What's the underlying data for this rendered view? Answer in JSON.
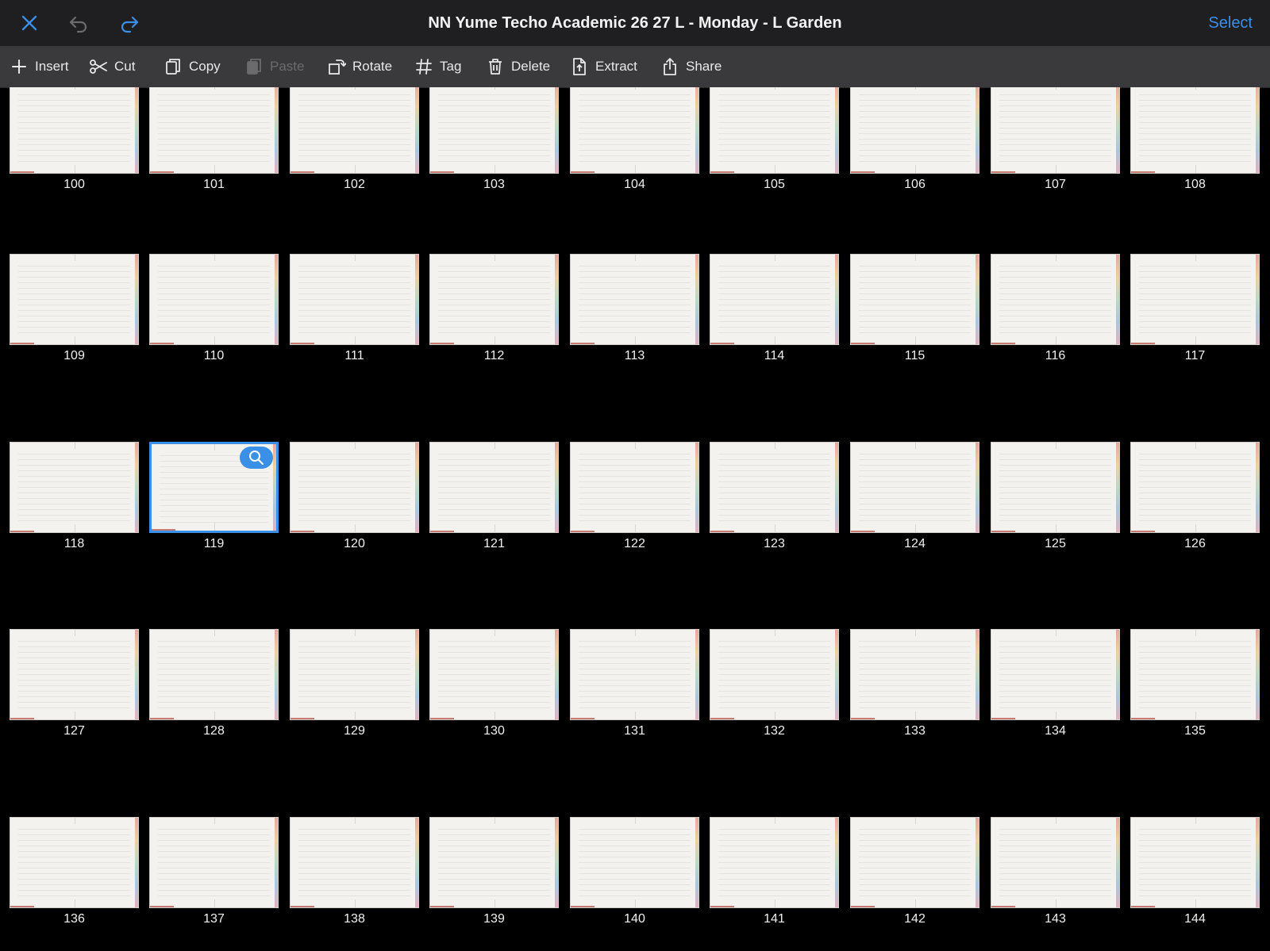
{
  "window": {
    "title": "NN Yume Techo Academic 26 27 L - Monday - L Garden",
    "select_label": "Select"
  },
  "colors": {
    "accent": "#3a8fe6",
    "titlebar_bg": "#1f1f21",
    "toolbar_bg": "#3a3a3c",
    "page_bg": "#000000"
  },
  "toolbar": {
    "items": [
      {
        "label": "Insert",
        "icon": "plus-icon",
        "enabled": true
      },
      {
        "label": "Cut",
        "icon": "scissors-icon",
        "enabled": true
      },
      {
        "label": "Copy",
        "icon": "copy-icon",
        "enabled": true
      },
      {
        "label": "Paste",
        "icon": "paste-icon",
        "enabled": false
      },
      {
        "label": "Rotate",
        "icon": "rotate-icon",
        "enabled": true
      },
      {
        "label": "Tag",
        "icon": "hashtag-icon",
        "enabled": true
      },
      {
        "label": "Delete",
        "icon": "trash-icon",
        "enabled": true
      },
      {
        "label": "Extract",
        "icon": "extract-icon",
        "enabled": true
      },
      {
        "label": "Share",
        "icon": "share-icon",
        "enabled": true
      }
    ]
  },
  "pages": {
    "rows": [
      [
        "100",
        "101",
        "102",
        "103",
        "104",
        "105",
        "106",
        "107",
        "108"
      ],
      [
        "109",
        "110",
        "111",
        "112",
        "113",
        "114",
        "115",
        "116",
        "117"
      ],
      [
        "118",
        "119",
        "120",
        "121",
        "122",
        "123",
        "124",
        "125",
        "126"
      ],
      [
        "127",
        "128",
        "129",
        "130",
        "131",
        "132",
        "133",
        "134",
        "135"
      ],
      [
        "136",
        "137",
        "138",
        "139",
        "140",
        "141",
        "142",
        "143",
        "144"
      ]
    ],
    "selected": "119"
  }
}
